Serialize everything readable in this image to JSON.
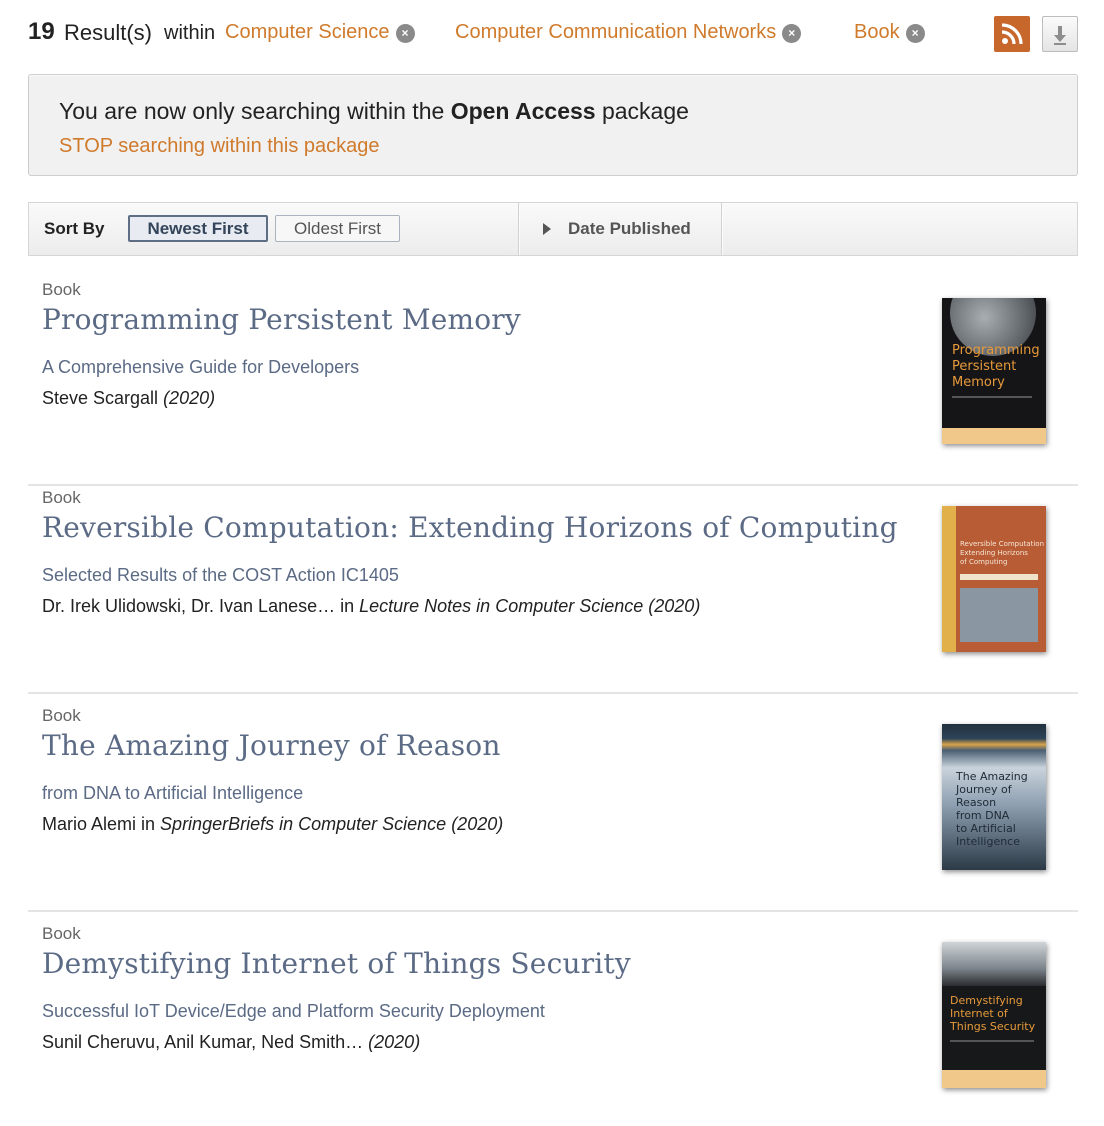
{
  "header": {
    "count": "19",
    "count_label": "Result(s)",
    "within": "within",
    "facets": [
      {
        "label": "Computer Science"
      },
      {
        "label": "Computer Communication Networks"
      },
      {
        "label": "Book"
      }
    ],
    "remove_glyph": "×",
    "icons": {
      "rss": "rss-icon",
      "download": "download-icon",
      "remove": "close-icon"
    }
  },
  "notice": {
    "text_before": "You are now only searching within the ",
    "package_name": "Open Access",
    "text_after": " package",
    "stop_link": "STOP searching within this package"
  },
  "sort": {
    "label": "Sort By",
    "newest": "Newest First",
    "oldest": "Oldest First",
    "date_published": "Date Published"
  },
  "results": [
    {
      "type": "Book",
      "title": "Programming Persistent Memory",
      "subtitle": "A Comprehensive Guide for Developers",
      "authors": "Steve Scargall ",
      "series_prefix": "",
      "series": "",
      "year": "(2020)",
      "cover_title": "Programming\nPersistent\nMemory"
    },
    {
      "type": "Book",
      "title": "Reversible Computation: Extending Horizons of Computing",
      "subtitle": "Selected Results of the COST Action IC1405",
      "authors": "Dr. Irek Ulidowski, Dr. Ivan Lanese…",
      "series_prefix": " in ",
      "series": "Lecture Notes in Computer Science",
      "year": " (2020)",
      "cover_title": "Reversible Computation\nExtending Horizons\nof Computing"
    },
    {
      "type": "Book",
      "title": "The Amazing Journey of Reason",
      "subtitle": "from DNA to Artificial Intelligence",
      "authors": "Mario Alemi",
      "series_prefix": " in ",
      "series": "SpringerBriefs in Computer Science",
      "year": " (2020)",
      "cover_title": "The Amazing\nJourney of\nReason\nfrom DNA\nto Artificial\nIntelligence"
    },
    {
      "type": "Book",
      "title": "Demystifying Internet of Things Security",
      "subtitle": "Successful IoT Device/Edge and Platform Security Deployment",
      "authors": "Sunil Cheruvu, Anil Kumar, Ned Smith… ",
      "series_prefix": "",
      "series": "",
      "year": "(2020)",
      "cover_title": "Demystifying\nInternet of\nThings Security"
    }
  ],
  "colors": {
    "accent_orange": "#d07a2c",
    "title_blue": "#5b6a85",
    "rss_orange": "#c8672c"
  }
}
